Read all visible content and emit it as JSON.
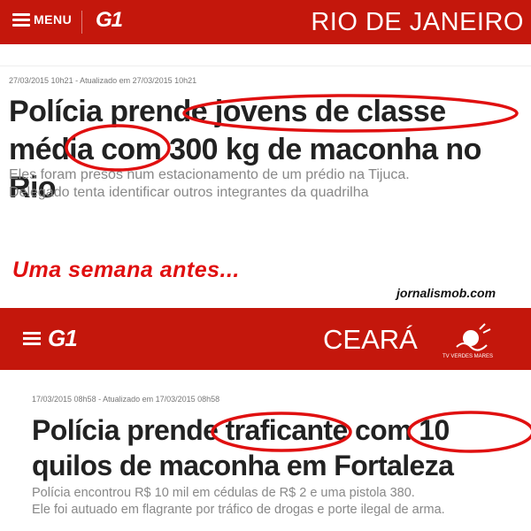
{
  "top": {
    "menu_label": "MENU",
    "logo": "G1",
    "region": "RIO DE JANEIRO",
    "date": "27/03/2015 10h21 - Atualizado em 27/03/2015 10h21",
    "title": "Polícia prende jovens de classe média com 300 kg de maconha no Rio",
    "subtitle_line1": "Eles foram presos num estacionamento de um prédio na Tijuca.",
    "subtitle_line2": "Delegado tenta identificar outros integrantes da quadrilha"
  },
  "caption": "Uma semana antes...",
  "credit": "jornalismob.com",
  "bottom": {
    "logo": "G1",
    "region": "CEARÁ",
    "tv_label": "TV VERDES MARES",
    "date": "17/03/2015 08h58 - Atualizado em 17/03/2015 08h58",
    "title": "Polícia prende traficante com 10 quilos de maconha em Fortaleza",
    "subtitle_line1": "Polícia encontrou R$ 10 mil em cédulas de R$ 2 e uma pistola 380.",
    "subtitle_line2": "Ele foi autuado em flagrante por tráfico de drogas e porte ilegal de arma."
  },
  "colors": {
    "g1_red": "#c4170c",
    "annotation_red": "#e01010"
  }
}
